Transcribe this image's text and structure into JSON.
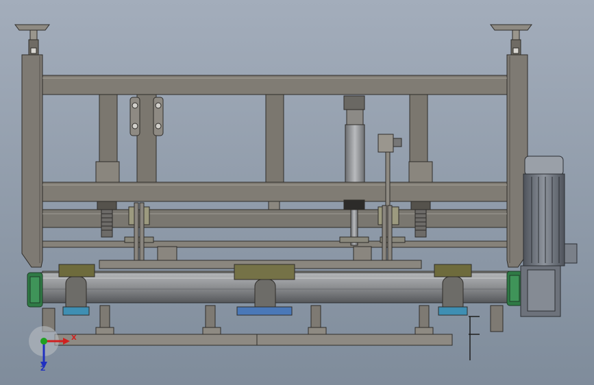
{
  "viewport": {
    "background_top": "#a3adbb",
    "background_bottom": "#7f8c9b",
    "steel_color": "#7e7a73",
    "steel_light": "#a29e95",
    "steel_dark": "#4f4c47",
    "roller_color": "#8a8c8f",
    "motor_color": "#6a6f78",
    "hub_color": "#2f7a45",
    "bearing_color": "#6e6b3c"
  },
  "triad": {
    "x_label": "X",
    "z_label": "Z",
    "x_color": "#d02020",
    "y_color": "#20a020",
    "z_color": "#2030c0"
  }
}
